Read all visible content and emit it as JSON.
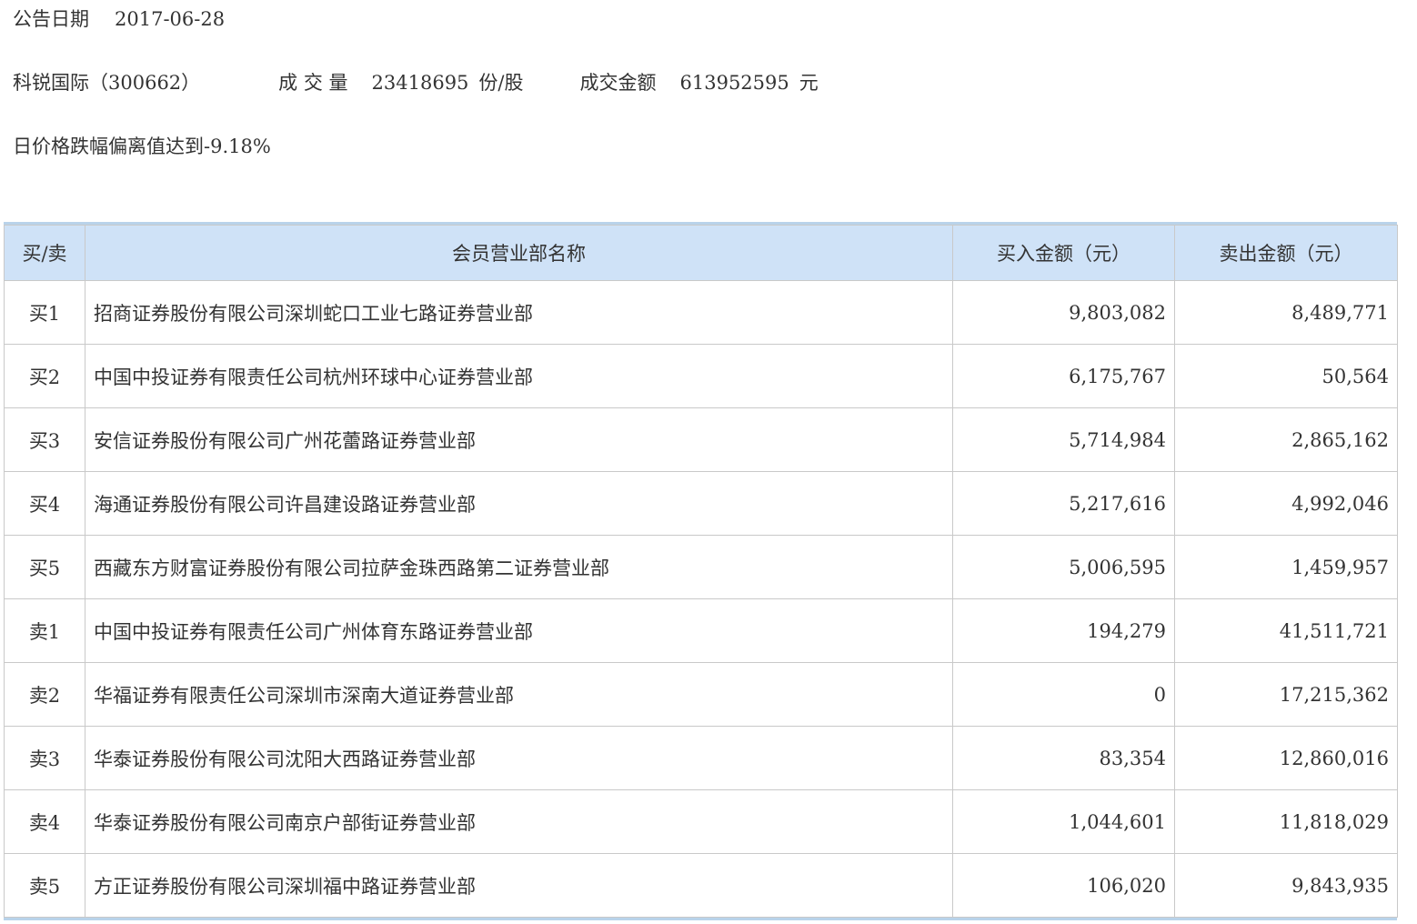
{
  "announcement": {
    "date_label": "公告日期",
    "date_value": "2017-06-28"
  },
  "stock": {
    "name_code": "科锐国际（300662）",
    "volume_label": "成 交 量",
    "volume_value": "23418695",
    "volume_unit": "份/股",
    "amount_label": "成交金额",
    "amount_value": "613952595",
    "amount_unit": "元"
  },
  "reason": "日价格跌幅偏离值达到-9.18%",
  "table": {
    "headers": {
      "side": "买/卖",
      "name": "会员营业部名称",
      "buy": "买入金额（元）",
      "sell": "卖出金额（元）"
    },
    "rows": [
      {
        "side": "买1",
        "name": "招商证券股份有限公司深圳蛇口工业七路证券营业部",
        "buy": "9,803,082",
        "sell": "8,489,771"
      },
      {
        "side": "买2",
        "name": "中国中投证券有限责任公司杭州环球中心证券营业部",
        "buy": "6,175,767",
        "sell": "50,564"
      },
      {
        "side": "买3",
        "name": "安信证券股份有限公司广州花蕾路证券营业部",
        "buy": "5,714,984",
        "sell": "2,865,162"
      },
      {
        "side": "买4",
        "name": "海通证券股份有限公司许昌建设路证券营业部",
        "buy": "5,217,616",
        "sell": "4,992,046"
      },
      {
        "side": "买5",
        "name": "西藏东方财富证券股份有限公司拉萨金珠西路第二证券营业部",
        "buy": "5,006,595",
        "sell": "1,459,957"
      },
      {
        "side": "卖1",
        "name": "中国中投证券有限责任公司广州体育东路证券营业部",
        "buy": "194,279",
        "sell": "41,511,721"
      },
      {
        "side": "卖2",
        "name": "华福证券有限责任公司深圳市深南大道证券营业部",
        "buy": "0",
        "sell": "17,215,362"
      },
      {
        "side": "卖3",
        "name": "华泰证券股份有限公司沈阳大西路证券营业部",
        "buy": "83,354",
        "sell": "12,860,016"
      },
      {
        "side": "卖4",
        "name": "华泰证券股份有限公司南京户部街证券营业部",
        "buy": "1,044,601",
        "sell": "11,818,029"
      },
      {
        "side": "卖5",
        "name": "方正证券股份有限公司深圳福中路证券营业部",
        "buy": "106,020",
        "sell": "9,843,935"
      }
    ]
  }
}
